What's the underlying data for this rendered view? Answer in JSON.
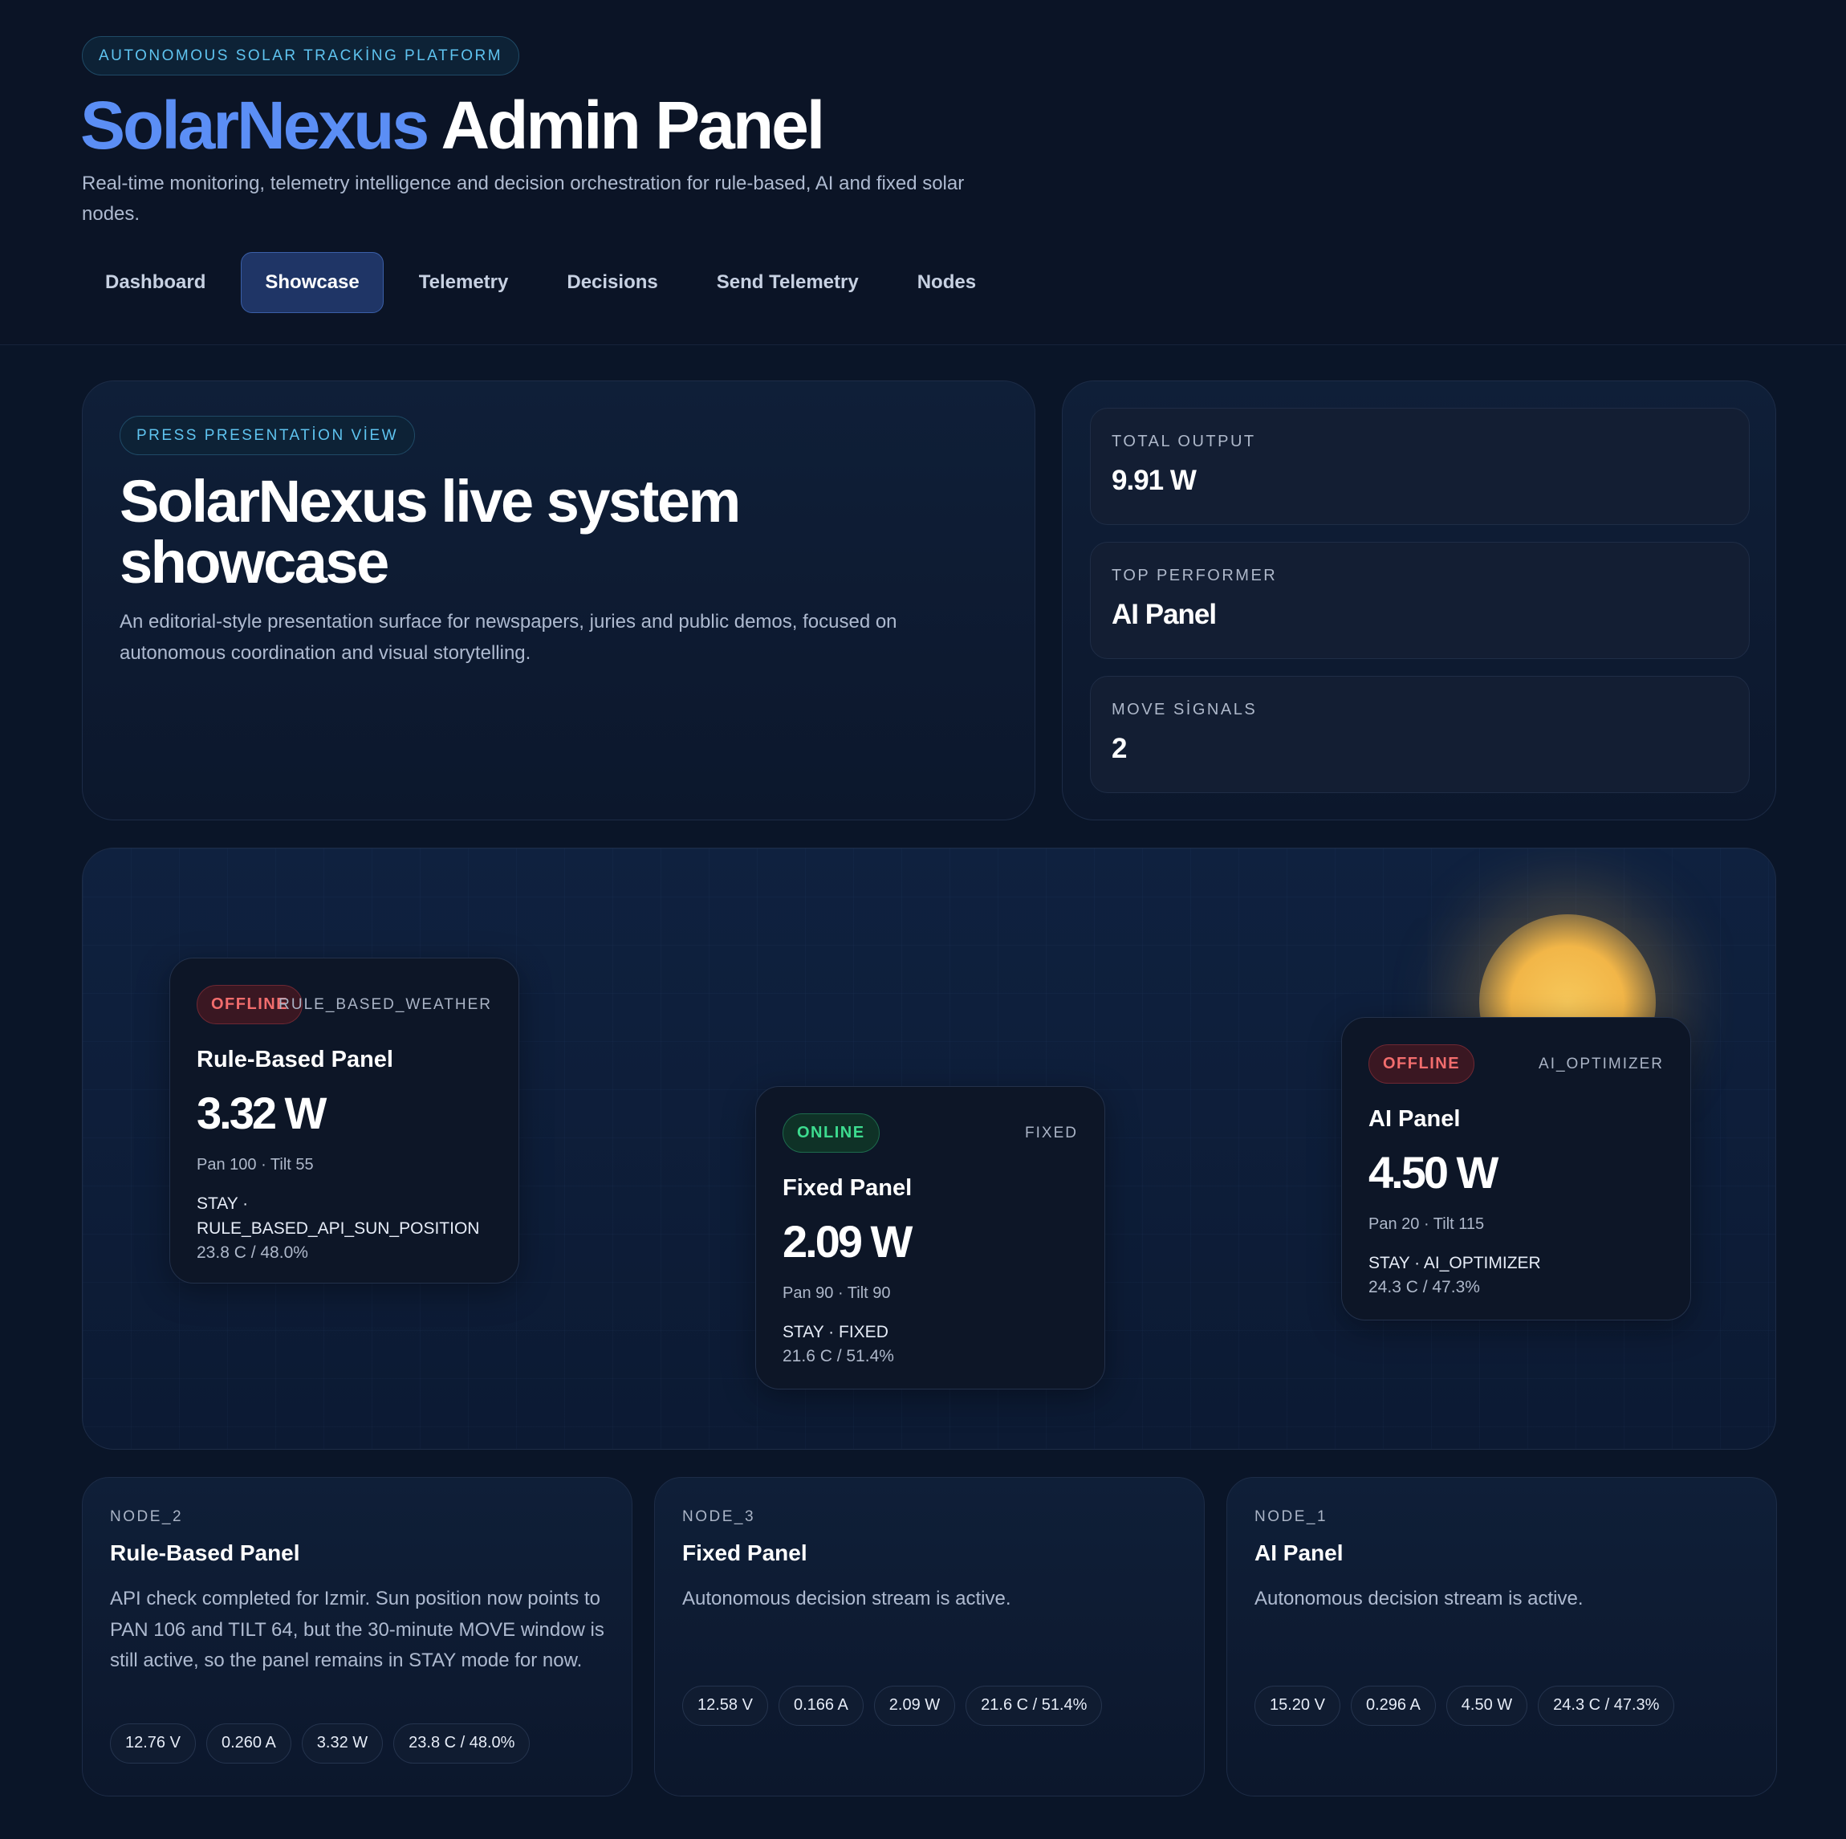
{
  "header": {
    "eyebrow": "AUTONOMOUS SOLAR TRACKİNG PLATFORM",
    "title_brand": "SolarNexus",
    "title_rest": "Admin Panel",
    "subtitle": "Real-time monitoring, telemetry intelligence and decision orchestration for rule-based, AI and fixed solar nodes.",
    "nav": [
      {
        "label": "Dashboard",
        "active": false
      },
      {
        "label": "Showcase",
        "active": true
      },
      {
        "label": "Telemetry",
        "active": false
      },
      {
        "label": "Decisions",
        "active": false
      },
      {
        "label": "Send Telemetry",
        "active": false
      },
      {
        "label": "Nodes",
        "active": false
      }
    ]
  },
  "hero": {
    "pill": "PRESS PRESENTATİON VİEW",
    "title": "SolarNexus live system showcase",
    "description": "An editorial-style presentation surface for newspapers, juries and public demos, focused on autonomous coordination and visual storytelling."
  },
  "stats": [
    {
      "label": "TOTAL OUTPUT",
      "value": "9.91 W"
    },
    {
      "label": "TOP PERFORMER",
      "value": "AI Panel"
    },
    {
      "label": "MOVE SİGNALS",
      "value": "2"
    }
  ],
  "stage_nodes": [
    {
      "status": "OFFLINE",
      "mode": "RULE_BASED_WEATHER",
      "title": "Rule-Based Panel",
      "power": "3.32 W",
      "pan_tilt": "Pan 100 · Tilt 55",
      "decision": "STAY · RULE_BASED_API_SUN_POSITION",
      "env": "23.8 C / 48.0%"
    },
    {
      "status": "ONLINE",
      "mode": "FIXED",
      "title": "Fixed Panel",
      "power": "2.09 W",
      "pan_tilt": "Pan 90 · Tilt 90",
      "decision": "STAY · FIXED",
      "env": "21.6 C / 51.4%"
    },
    {
      "status": "OFFLINE",
      "mode": "AI_OPTIMIZER",
      "title": "AI Panel",
      "power": "4.50 W",
      "pan_tilt": "Pan 20 · Tilt 115",
      "decision": "STAY · AI_OPTIMIZER",
      "env": "24.3 C / 47.3%"
    }
  ],
  "details": [
    {
      "id": "NODE_2",
      "title": "Rule-Based Panel",
      "text": "API check completed for Izmir. Sun position now points to PAN 106 and TILT 64, but the 30-minute MOVE window is still active, so the panel remains in STAY mode for now.",
      "chips": [
        "12.76 V",
        "0.260 A",
        "3.32 W",
        "23.8 C / 48.0%"
      ]
    },
    {
      "id": "NODE_3",
      "title": "Fixed Panel",
      "text": "Autonomous decision stream is active.",
      "chips": [
        "12.58 V",
        "0.166 A",
        "2.09 W",
        "21.6 C / 51.4%"
      ]
    },
    {
      "id": "NODE_1",
      "title": "AI Panel",
      "text": "Autonomous decision stream is active.",
      "chips": [
        "15.20 V",
        "0.296 A",
        "4.50 W",
        "24.3 C / 47.3%"
      ]
    }
  ]
}
